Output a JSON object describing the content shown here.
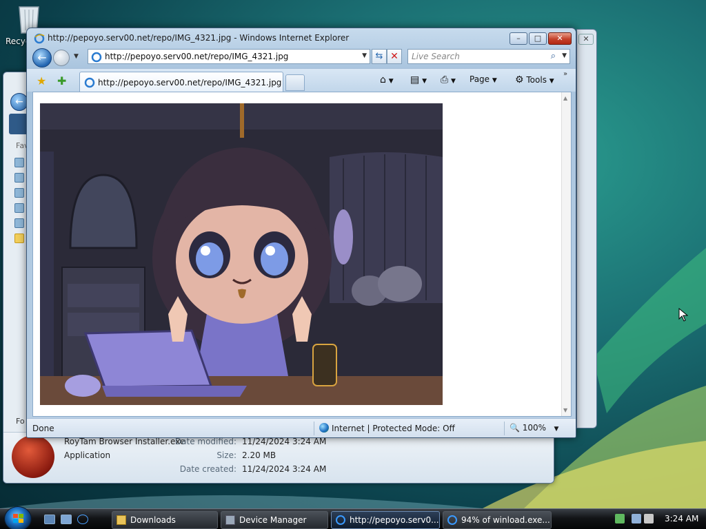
{
  "desktop": {
    "recycle_bin_label": "Recyc"
  },
  "explorer": {
    "favorites_label": "Fav",
    "folders_label": "Fo",
    "details": {
      "file_name": "RoyTam Browser Installer.exe",
      "file_type": "Application",
      "modified_label": "Date modified:",
      "modified_value": "11/24/2024 3:24 AM",
      "size_label": "Size:",
      "size_value": "2.20 MB",
      "created_label": "Date created:",
      "created_value": "11/24/2024 3:24 AM"
    }
  },
  "ie": {
    "title": "http://pepoyo.serv00.net/repo/IMG_4321.jpg - Windows Internet Explorer",
    "window_buttons": {
      "minimize": "–",
      "maximize": "□",
      "close": "✕"
    },
    "back_glyph": "←",
    "address_url": "http://pepoyo.serv00.net/repo/IMG_4321.jpg",
    "refresh_glyph": "⇆",
    "stop_glyph": "✕",
    "search_placeholder": "Live Search",
    "search_glyph": "⌕",
    "dropdown_glyph": "▼",
    "tab_label": "http://pepoyo.serv00.net/repo/IMG_4321.jpg",
    "favorites_glyph": "★",
    "add_favorites_glyph": "✚",
    "commands": {
      "home_glyph": "⌂",
      "feeds_glyph": "▤",
      "print_glyph": "⎙",
      "page_label": "Page",
      "tools_label": "Tools",
      "tools_glyph": "⚙",
      "more_glyph": "»"
    },
    "status": {
      "text": "Done",
      "zone": "Internet | Protected Mode: Off",
      "zoom": "100%"
    }
  },
  "taskbar": {
    "tasks": [
      {
        "label": "Downloads"
      },
      {
        "label": "Device Manager"
      },
      {
        "label": "http://pepoyo.serv0..."
      },
      {
        "label": "94% of winload.exe...."
      }
    ],
    "clock": "3:24 AM"
  },
  "colors": {
    "desktop_teal": "#1b6f73",
    "ie_frame": "#b9cfe4",
    "taskbar": "#121417",
    "close_red": "#c4412a"
  }
}
